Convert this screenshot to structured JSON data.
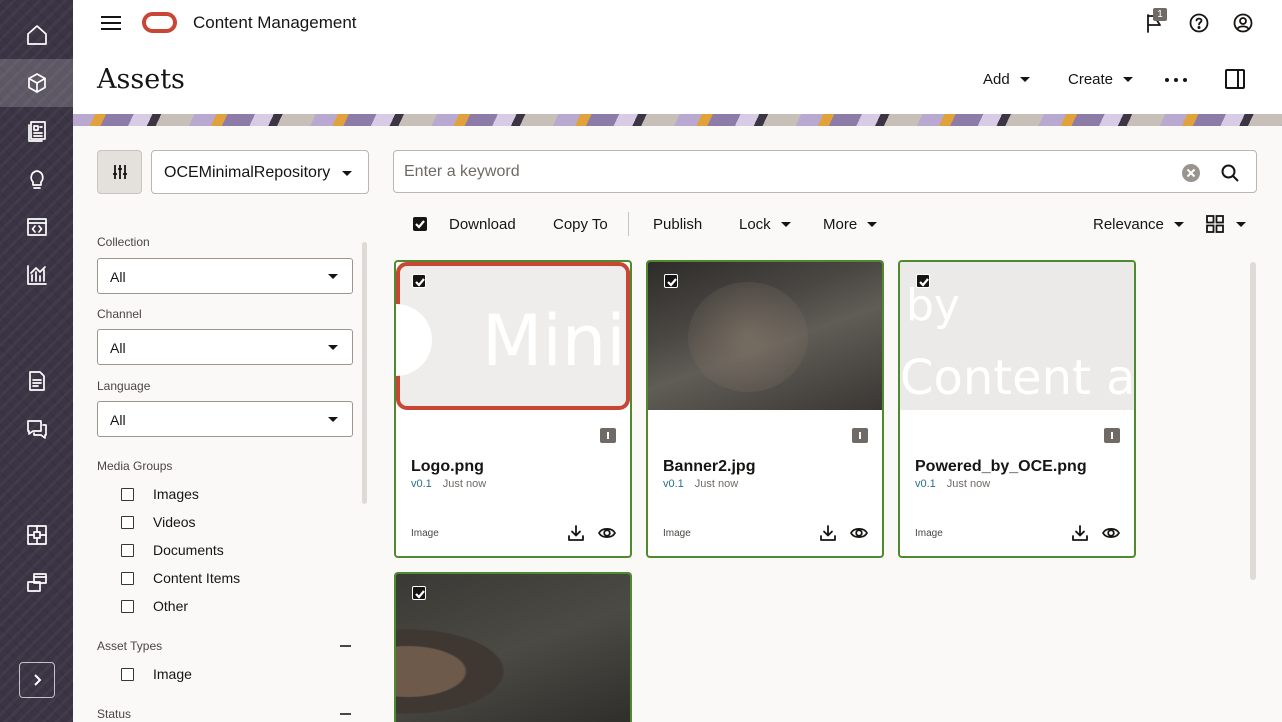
{
  "rail": {
    "items": [
      {
        "icon": "home-icon"
      },
      {
        "icon": "assets-cube-icon",
        "active": true
      },
      {
        "icon": "content-icon"
      },
      {
        "icon": "lightbulb-icon"
      },
      {
        "icon": "code-window-icon"
      },
      {
        "icon": "analytics-chart-icon"
      },
      {
        "icon": "document-icon"
      },
      {
        "icon": "conversations-icon"
      },
      {
        "icon": "integrations-icon"
      },
      {
        "icon": "sites-icon"
      }
    ],
    "expand_icon": "chevron-right-icon"
  },
  "topbar": {
    "app_title": "Content Management",
    "notification_count": "1"
  },
  "page": {
    "title": "Assets",
    "add_label": "Add",
    "create_label": "Create"
  },
  "repository": {
    "selected": "OCEMinimalRepository"
  },
  "filters": {
    "collection": {
      "label": "Collection",
      "value": "All"
    },
    "channel": {
      "label": "Channel",
      "value": "All"
    },
    "language": {
      "label": "Language",
      "value": "All"
    },
    "media_groups": {
      "label": "Media Groups",
      "options": [
        "Images",
        "Videos",
        "Documents",
        "Content Items",
        "Other"
      ]
    },
    "asset_types": {
      "label": "Asset Types",
      "options": [
        "Image"
      ]
    },
    "status": {
      "label": "Status"
    }
  },
  "search": {
    "placeholder": "Enter a keyword",
    "value": ""
  },
  "toolbar": {
    "download": "Download",
    "copy_to": "Copy To",
    "publish": "Publish",
    "lock": "Lock",
    "more": "More",
    "sort": "Relevance"
  },
  "assets": [
    {
      "name": "Logo.png",
      "version": "v0.1",
      "time": "Just now",
      "type": "Image",
      "thumb_text": "Mini",
      "selected": true
    },
    {
      "name": "Banner2.jpg",
      "version": "v0.1",
      "time": "Just now",
      "type": "Image",
      "selected": true
    },
    {
      "name": "Powered_by_OCE.png",
      "version": "v0.1",
      "time": "Just now",
      "type": "Image",
      "thumb_text_1": "by",
      "thumb_text_2": "Content a",
      "selected": true
    },
    {
      "name": "",
      "selected": true
    }
  ],
  "colors": {
    "rail_bg": "#3a3444",
    "card_border": "#4f8a2f",
    "brand_red": "#c74634",
    "version_link": "#2a6f8c"
  }
}
